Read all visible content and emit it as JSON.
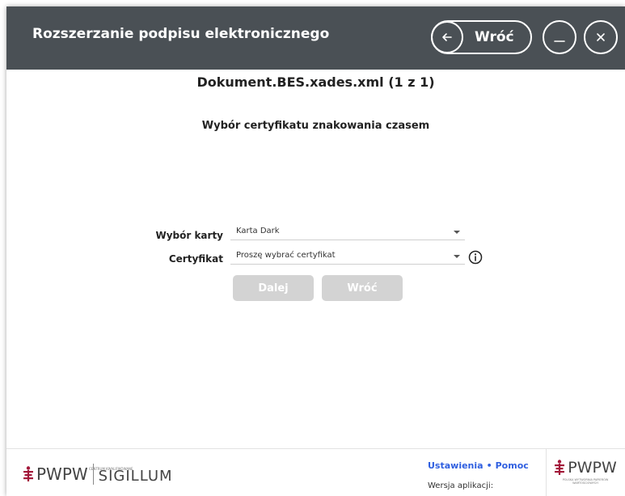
{
  "header": {
    "title": "Rozszerzanie podpisu elektronicznego",
    "back_label": "Wróć",
    "icons": [
      "arrow-left-icon",
      "minimize-icon",
      "close-icon"
    ],
    "background_color": "#4a5055"
  },
  "main": {
    "document_title": "Dokument.BES.xades.xml (1 z 1)",
    "section_title": "Wybór certyfikatu znakowania czasem",
    "card_label": "Wybór karty",
    "card_value": "Karta Dark",
    "certificate_label": "Certyfikat",
    "certificate_placeholder": "Proszę wybrać certyfikat",
    "next_button": "Dalej",
    "back_button": "Wróć",
    "disabled_button_color": "#d3d3d3"
  },
  "footer": {
    "logo_left_text": "PWPW",
    "logo_left_small": "CENTRUM KWALIFIKOWANE",
    "logo_left_brand": "SIGILLUM",
    "settings_link": "Ustawienia",
    "help_link": "Pomoc",
    "link_color": "#2f5fe0",
    "version_label": "Wersja aplikacji:",
    "logo_right_text": "PWPW",
    "logo_right_caption": "POLSKA WYTWÓRNIA PAPIERÓW WARTOŚCIOWYCH",
    "logo_color": "#a3193b"
  }
}
